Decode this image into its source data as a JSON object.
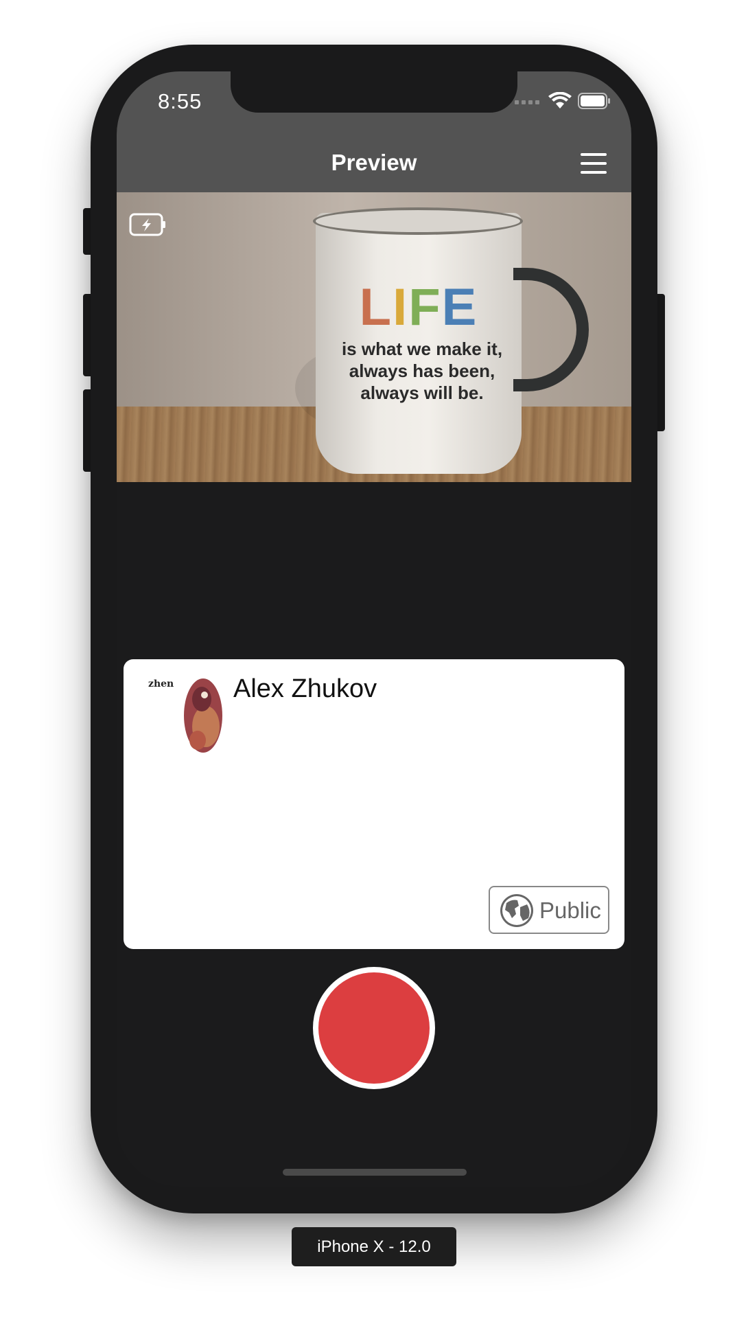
{
  "status_bar": {
    "time": "8:55"
  },
  "nav": {
    "title": "Preview"
  },
  "preview": {
    "mug_word": [
      "L",
      "I",
      "F",
      "E"
    ],
    "mug_lines": [
      "is what we make it,",
      "always has been,",
      "always will be."
    ]
  },
  "card": {
    "user_name": "Alex Zhukov",
    "avatar_text": "zhen",
    "visibility_label": "Public"
  },
  "simulator": {
    "device_label": "iPhone X - 12.0"
  },
  "colors": {
    "header": "#535353",
    "screen_bg": "#1b1b1c",
    "record": "#dc3e40",
    "card_bg": "#ffffff"
  },
  "icons": [
    "signal-icon",
    "wifi-icon",
    "battery-icon",
    "menu-icon",
    "charging-icon",
    "globe-icon",
    "record-icon"
  ]
}
